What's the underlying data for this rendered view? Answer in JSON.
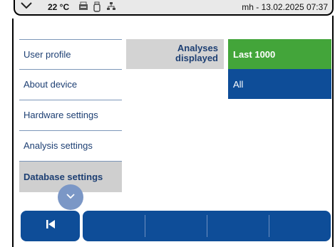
{
  "status_bar": {
    "temperature": "22 °C",
    "user_time": "mh - 13.02.2025 07:37",
    "icons": [
      "chevron-down-icon",
      "printer-icon",
      "usb-icon",
      "network-icon"
    ]
  },
  "menu": {
    "items": [
      {
        "label": "User profile"
      },
      {
        "label": "About device"
      },
      {
        "label": "Hardware settings"
      },
      {
        "label": "Analysis settings"
      },
      {
        "label": "Database settings",
        "selected": true
      }
    ]
  },
  "setting": {
    "label_line1": "Analyses",
    "label_line2": "displayed",
    "options": [
      {
        "label": "Last 1000",
        "selected": true
      },
      {
        "label": "All",
        "selected": false
      }
    ]
  },
  "bottom_bar": {
    "back_icon": "skip-back-icon",
    "scroll_icon": "chevron-down-icon"
  },
  "colors": {
    "primary_blue": "#0e4d98",
    "selected_green": "#43a53a",
    "text_blue": "#1d3f73",
    "selected_gray": "#cfcfcf"
  }
}
